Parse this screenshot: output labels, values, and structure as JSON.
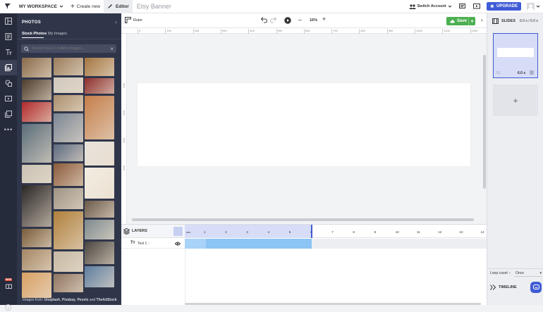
{
  "topbar": {
    "workspace_label": "MY WORKSPACE",
    "create_label": "Create new",
    "editor_label": "Editor",
    "doc_title": "Etsy Banner",
    "switch_account_label": "Switch Account",
    "upgrade_label": "UPGRADE"
  },
  "panel": {
    "title": "PHOTOS",
    "tabs": [
      "Stock Photos",
      "My Images"
    ],
    "search_placeholder": "Search over 2 million images...",
    "footer_prefix": "Images from: ",
    "footer_sources": [
      "Unsplash",
      "Pixabay",
      "Pexels",
      "TheAdStock"
    ],
    "footer_sep": ", ",
    "footer_and": " and "
  },
  "toolbar": {
    "ruler_label": "Ruler",
    "zoom": "16%",
    "save_label": "Save"
  },
  "ruler": {
    "h_ticks": [
      "0",
      "100",
      "200",
      "300",
      "400",
      "500",
      "600",
      "700",
      "800",
      "900",
      "1000",
      "1100",
      "1200"
    ],
    "v_ticks": [
      "100",
      "200",
      "300",
      "400"
    ]
  },
  "slides": {
    "title": "SLIDES",
    "total": "6.0 s / 6.0 s",
    "slide_index": "01",
    "slide_duration": "6.0 s",
    "add_symbol": "+"
  },
  "timeline": {
    "layers_label": "LAYERS",
    "sec_label": "sec",
    "ticks": [
      "1",
      "2",
      "3",
      "4",
      "5",
      "6",
      "7",
      "8",
      "9",
      "10",
      "11",
      "12",
      "13",
      "14"
    ],
    "layer_name": "Text 1 -",
    "loop_label": "Loop count",
    "loop_value": "Once",
    "timeline_button": "TIMELINE"
  },
  "colors": {
    "rail": "#262b3b",
    "panel": "#30364a",
    "accent": "#3f5bd5",
    "save": "#4caf50",
    "track": "#8cc4f5",
    "slide_bg": "#d7dcf7"
  },
  "photos": [
    {
      "col": 0,
      "color": "#8a6a4a"
    },
    {
      "col": 0,
      "color": "#4d3b2c"
    },
    {
      "col": 0,
      "color": "#b22a2a"
    },
    {
      "col": 0,
      "color": "#5a6d7a"
    },
    {
      "col": 0,
      "color": "#c9c2b5"
    },
    {
      "col": 0,
      "color": "#2a2626"
    },
    {
      "col": 0,
      "color": "#7a5d3a"
    },
    {
      "col": 0,
      "color": "#a58763"
    },
    {
      "col": 0,
      "color": "#d9a063"
    },
    {
      "col": 1,
      "color": "#9b7d5c"
    },
    {
      "col": 1,
      "color": "#cfc8be"
    },
    {
      "col": 1,
      "color": "#ab8f6e"
    },
    {
      "col": 1,
      "color": "#7b8696"
    },
    {
      "col": 1,
      "color": "#5c6a80"
    },
    {
      "col": 1,
      "color": "#8b5a3a"
    },
    {
      "col": 1,
      "color": "#9d9384"
    },
    {
      "col": 1,
      "color": "#b07f3b"
    },
    {
      "col": 1,
      "color": "#c5b9a5"
    },
    {
      "col": 1,
      "color": "#8f7560"
    },
    {
      "col": 2,
      "color": "#a47640"
    },
    {
      "col": 2,
      "color": "#8e2f2f"
    },
    {
      "col": 2,
      "color": "#c47e4a"
    },
    {
      "col": 2,
      "color": "#e8e3dc"
    },
    {
      "col": 2,
      "color": "#f2ede2"
    },
    {
      "col": 2,
      "color": "#6b5a49"
    },
    {
      "col": 2,
      "color": "#7d8a8f"
    },
    {
      "col": 2,
      "color": "#4a4540"
    },
    {
      "col": 2,
      "color": "#5d7da0"
    }
  ]
}
